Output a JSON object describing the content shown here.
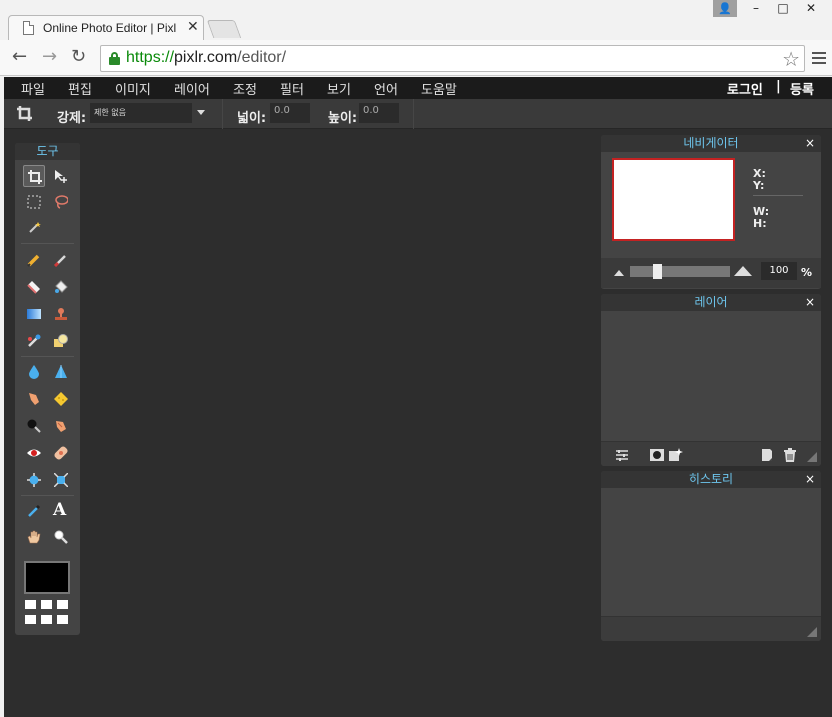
{
  "browser": {
    "tab_title": "Online Photo Editor | Pixl",
    "url_scheme": "https://",
    "url_host": "pixlr.com",
    "url_path": "/editor/"
  },
  "menubar": {
    "items": [
      "파일",
      "편집",
      "이미지",
      "레이어",
      "조정",
      "필터",
      "보기",
      "언어",
      "도움말"
    ],
    "login": "로그인",
    "separator": "|",
    "register": "등록"
  },
  "options": {
    "constraint_label": "강제:",
    "constraint_value": "제한 없음",
    "width_label": "넓이:",
    "width_value": "0.0",
    "height_label": "높이:",
    "height_value": "0.0"
  },
  "tools": {
    "title": "도구"
  },
  "navigator": {
    "title": "네비게이터",
    "close": "×",
    "x_label": "X:",
    "y_label": "Y:",
    "w_label": "W:",
    "h_label": "H:",
    "zoom_value": "100",
    "zoom_unit": "%"
  },
  "layers": {
    "title": "레이어",
    "close": "×"
  },
  "history": {
    "title": "히스토리",
    "close": "×"
  }
}
